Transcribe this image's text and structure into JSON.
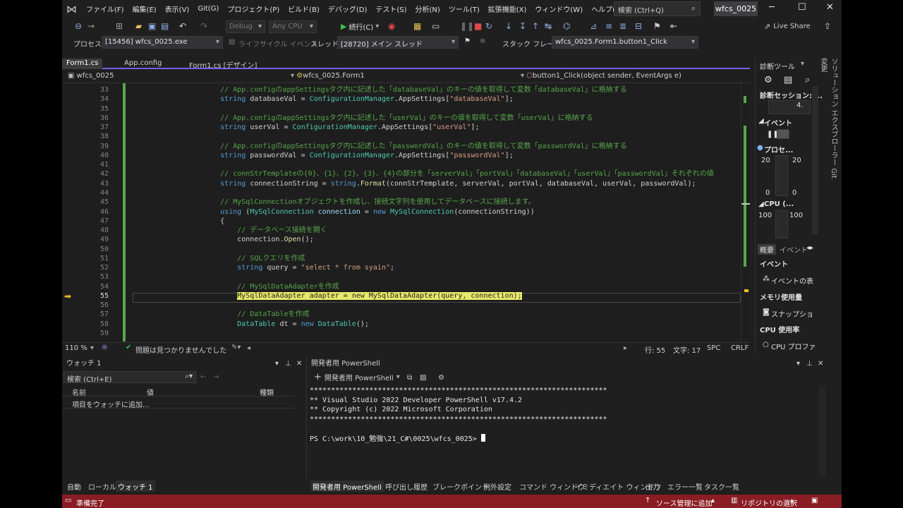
{
  "menu": {
    "items": [
      "ファイル(F)",
      "編集(E)",
      "表示(V)",
      "Git(G)",
      "プロジェクト(P)",
      "ビルド(B)",
      "デバッグ(D)",
      "テスト(S)",
      "分析(N)",
      "ツール(T)",
      "拡張機能(X)",
      "ウィンドウ(W)",
      "ヘルプ(H)"
    ],
    "search_placeholder": "検索 (Ctrl+Q)",
    "solution_name": "wfcs_0025"
  },
  "toolbar": {
    "config": "Debug",
    "platform": "Any CPU",
    "continue_label": "続行(C)",
    "live_share": "Live Share"
  },
  "debugbar": {
    "process_label": "プロセス:",
    "process_value": "[15456] wfcs_0025.exe",
    "lifecycle_label": "ライフサイクル イベント",
    "thread_label": "スレッド:",
    "thread_value": "[28720] メイン スレッド",
    "stackframe_label": "スタック フレーム:",
    "stackframe_value": "wfcs_0025.Form1.button1_Click"
  },
  "doc_tabs": [
    "Form1.cs",
    "App.config",
    "Form1.cs [デザイン]"
  ],
  "navbar": {
    "project": "wfcs_0025",
    "class": "wfcs_0025.Form1",
    "member": "button1_Click(object sender, EventArgs e)"
  },
  "editor": {
    "current_line": 55,
    "lines": [
      {
        "n": "33",
        "segs": [
          {
            "c": "cm",
            "t": "        // App.configのappSettingsタグ内に記述した「databaseVal」のキーの値を取得して変数「databaseVal」に格納する"
          }
        ]
      },
      {
        "n": "34",
        "segs": [
          {
            "c": "kw",
            "t": "        string"
          },
          {
            "c": "pl",
            "t": " databaseVal = "
          },
          {
            "c": "ty",
            "t": "ConfigurationManager"
          },
          {
            "c": "pl",
            "t": ".AppSettings["
          },
          {
            "c": "st",
            "t": "\"databaseVal\""
          },
          {
            "c": "pl",
            "t": "];"
          }
        ]
      },
      {
        "n": "35",
        "segs": []
      },
      {
        "n": "36",
        "segs": [
          {
            "c": "cm",
            "t": "        // App.configのappSettingsタグ内に記述した「userVal」のキーの値を取得して変数「userVal」に格納する"
          }
        ]
      },
      {
        "n": "37",
        "segs": [
          {
            "c": "kw",
            "t": "        string"
          },
          {
            "c": "pl",
            "t": " userVal = "
          },
          {
            "c": "ty",
            "t": "ConfigurationManager"
          },
          {
            "c": "pl",
            "t": ".AppSettings["
          },
          {
            "c": "st",
            "t": "\"userVal\""
          },
          {
            "c": "pl",
            "t": "];"
          }
        ]
      },
      {
        "n": "38",
        "segs": []
      },
      {
        "n": "39",
        "segs": [
          {
            "c": "cm",
            "t": "        // App.configのappSettingsタグ内に記述した「passwordVal」のキーの値を取得して変数「passwordVal」に格納する"
          }
        ]
      },
      {
        "n": "40",
        "segs": [
          {
            "c": "kw",
            "t": "        string"
          },
          {
            "c": "pl",
            "t": " passwordVal = "
          },
          {
            "c": "ty",
            "t": "ConfigurationManager"
          },
          {
            "c": "pl",
            "t": ".AppSettings["
          },
          {
            "c": "st",
            "t": "\"passwordVal\""
          },
          {
            "c": "pl",
            "t": "];"
          }
        ]
      },
      {
        "n": "41",
        "segs": []
      },
      {
        "n": "42",
        "segs": [
          {
            "c": "cm",
            "t": "        // connStrTemplateの{0}、{1}、{2}、{3}、{4}の部分を「serverVal」「portVal」「databaseVal」「userVal」「passwordVal」それぞれの値"
          }
        ]
      },
      {
        "n": "43",
        "segs": [
          {
            "c": "kw",
            "t": "        string"
          },
          {
            "c": "pl",
            "t": " connectionString = "
          },
          {
            "c": "kw",
            "t": "string"
          },
          {
            "c": "pl",
            "t": "."
          },
          {
            "c": "mt",
            "t": "Format"
          },
          {
            "c": "pl",
            "t": "(connStrTemplate, serverVal, portVal, databaseVal, userVal, passwordVal);"
          }
        ]
      },
      {
        "n": "44",
        "segs": []
      },
      {
        "n": "45",
        "segs": [
          {
            "c": "cm",
            "t": "        // MySqlConnectionオブジェクトを作成し、接続文字列を使用してデータベースに接続します。"
          }
        ]
      },
      {
        "n": "46",
        "segs": [
          {
            "c": "kw",
            "t": "        using"
          },
          {
            "c": "pl",
            "t": " ("
          },
          {
            "c": "ty",
            "t": "MySqlConnection"
          },
          {
            "c": "id",
            "t": " connection"
          },
          {
            "c": "pl",
            "t": " = "
          },
          {
            "c": "kw",
            "t": "new"
          },
          {
            "c": "ty",
            "t": " MySqlConnection"
          },
          {
            "c": "pl",
            "t": "(connectionString))"
          }
        ]
      },
      {
        "n": "47",
        "segs": [
          {
            "c": "pl",
            "t": "        {"
          }
        ]
      },
      {
        "n": "48",
        "segs": [
          {
            "c": "cm",
            "t": "            // データベース接続を開く"
          }
        ]
      },
      {
        "n": "49",
        "segs": [
          {
            "c": "pl",
            "t": "            connection."
          },
          {
            "c": "mt",
            "t": "Open"
          },
          {
            "c": "pl",
            "t": "();"
          }
        ]
      },
      {
        "n": "50",
        "segs": []
      },
      {
        "n": "51",
        "segs": [
          {
            "c": "cm",
            "t": "            // SQLクエリを作成"
          }
        ]
      },
      {
        "n": "52",
        "segs": [
          {
            "c": "kw",
            "t": "            string"
          },
          {
            "c": "pl",
            "t": " query = "
          },
          {
            "c": "st",
            "t": "\"select * from syain\""
          },
          {
            "c": "pl",
            "t": ";"
          }
        ]
      },
      {
        "n": "53",
        "segs": []
      },
      {
        "n": "54",
        "segs": [
          {
            "c": "cm",
            "t": "            // MySqlDataAdapterを作成"
          }
        ]
      },
      {
        "n": "55",
        "hl": true,
        "segs": [
          {
            "c": "pl",
            "t": "            "
          },
          {
            "c": "hl",
            "t": "MySqlDataAdapter adapter = new MySqlDataAdapter(query, connection);"
          }
        ]
      },
      {
        "n": "56",
        "segs": []
      },
      {
        "n": "57",
        "segs": [
          {
            "c": "cm",
            "t": "            // DataTableを作成"
          }
        ]
      },
      {
        "n": "58",
        "segs": [
          {
            "c": "ty",
            "t": "            DataTable"
          },
          {
            "c": "pl",
            "t": " dt = "
          },
          {
            "c": "kw",
            "t": "new"
          },
          {
            "c": "ty",
            "t": " DataTable"
          },
          {
            "c": "pl",
            "t": "();"
          }
        ]
      },
      {
        "n": "59",
        "segs": []
      }
    ]
  },
  "editor_status": {
    "zoom": "110 %",
    "issues": "問題は見つかりませんでした",
    "line": "行: 55",
    "col": "文字: 17",
    "spc": "SPC",
    "crlf": "CRLF"
  },
  "diagnostics": {
    "title": "診断ツール",
    "session": "診断セッション: ...",
    "session_value": "4.",
    "events": "イベント",
    "process": "プロセ...",
    "mem_top_left": "20",
    "mem_top_right": "20",
    "mem_bottom_left": "0",
    "mem_bottom_right": "0",
    "cpu": "CPU (...",
    "cpu_left": "100",
    "cpu_right": "100",
    "tab_summary": "概要",
    "tab_events": "イベント",
    "sec_events": "イベント",
    "event_item": "イベントの表",
    "sec_memory": "メモリ使用量",
    "snapshot": "スナップショ",
    "sec_cpu": "CPU 使用率",
    "cpu_profile": "CPU プロファ"
  },
  "side_tabs": "ソリューション エクスプローラー   Git 変更",
  "watch": {
    "title": "ウォッチ 1",
    "search_placeholder": "検索 (Ctrl+E)",
    "col_name": "名前",
    "col_value": "値",
    "col_type": "種類",
    "add_item": "項目をウォッチに追加..."
  },
  "powershell": {
    "title": "開発者用 PowerShell",
    "new_button": "開発者用 PowerShell",
    "output": [
      "**********************************************************************",
      "** Visual Studio 2022 Developer PowerShell v17.4.2",
      "** Copyright (c) 2022 Microsoft Corporation",
      "**********************************************************************",
      "PS C:\\work\\10_勉強\\21_C#\\0025\\wfcs_0025> "
    ]
  },
  "bottom_tabs_left": [
    "自動",
    "ローカル",
    "ウォッチ 1"
  ],
  "bottom_tabs_right": [
    "開発者用 PowerShell",
    "呼び出し履歴",
    "ブレークポイント",
    "例外設定",
    "コマンド ウィンドウ",
    "イミディエイト ウィンドウ",
    "出力",
    "エラー一覧",
    "タスク一覧"
  ],
  "statusbar": {
    "ready": "準備完了",
    "source_control": "ソース管理に追加",
    "repository": "リポジトリの選択"
  },
  "colors": {
    "accent": "#7160e8",
    "status_bg": "#8a1d24",
    "highlight": "#e9e96a",
    "comment": "#57a64a",
    "keyword": "#569cd6",
    "type": "#4ec9b0",
    "string": "#d69d85"
  }
}
